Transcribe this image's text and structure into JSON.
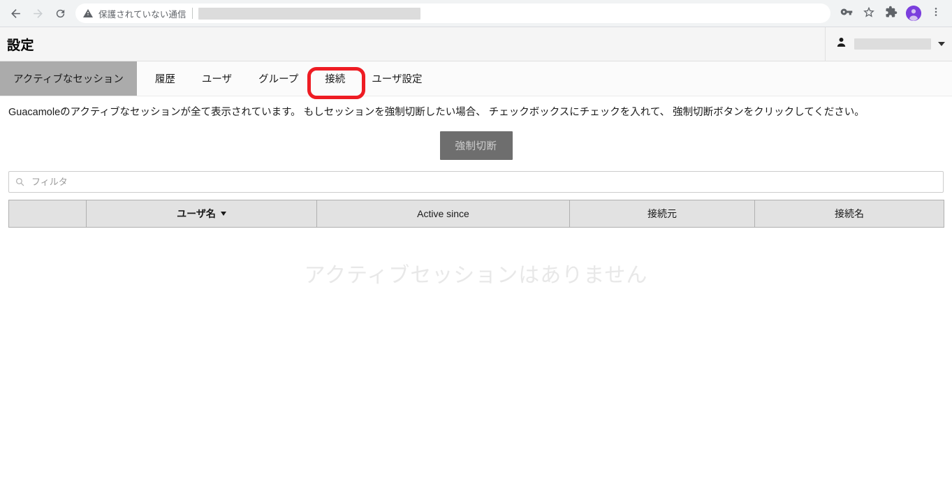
{
  "browser": {
    "back_icon": "arrow-left-icon",
    "forward_icon": "arrow-right-icon",
    "reload_icon": "reload-icon",
    "security_warning": "保護されていない通信",
    "url_value": "",
    "url_placeholder": "",
    "icons": {
      "password_key": "key-icon",
      "bookmark_star": "star-icon",
      "extensions": "puzzle-icon",
      "profile": "avatar-icon",
      "menu": "three-dot-menu-icon"
    },
    "avatar_color": "#7b3fdd"
  },
  "header": {
    "title": "設定",
    "user_icon": "person-icon",
    "user_name": "",
    "dropdown_icon": "chevron-down-icon"
  },
  "tabs": [
    {
      "label": "アクティブなセッション",
      "active": true,
      "annotated": false
    },
    {
      "label": "履歴",
      "active": false,
      "annotated": false
    },
    {
      "label": "ユーザ",
      "active": false,
      "annotated": false
    },
    {
      "label": "グループ",
      "active": false,
      "annotated": false
    },
    {
      "label": "接続",
      "active": false,
      "annotated": true
    },
    {
      "label": "ユーザ設定",
      "active": false,
      "annotated": false
    }
  ],
  "annotation": {
    "color": "#ee1c23",
    "shape": "rounded-rectangle",
    "target_tab": "接続"
  },
  "main": {
    "description": "Guacamoleのアクティブなセッションが全て表示されています。 もしセッションを強制切断したい場合、 チェックボックスにチェックを入れて、 強制切断ボタンをクリックしてください。",
    "disconnect_button": {
      "label": "強制切断",
      "disabled": true,
      "bg_color": "#6e6e6e",
      "text_color": "#cfcfcf"
    },
    "filter": {
      "placeholder": "フィルタ",
      "value": "",
      "icon": "search-icon"
    },
    "table": {
      "columns": [
        {
          "label": "",
          "sorted": false
        },
        {
          "label": "ユーザ名",
          "sorted": true,
          "sort_direction": "desc"
        },
        {
          "label": "Active since",
          "sorted": false
        },
        {
          "label": "接続元",
          "sorted": false
        },
        {
          "label": "接続名",
          "sorted": false
        }
      ],
      "rows": [],
      "empty_message": "アクティブセッションはありません"
    }
  }
}
